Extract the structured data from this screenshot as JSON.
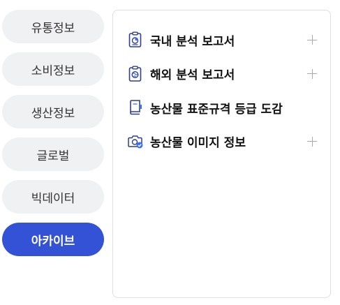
{
  "categories": [
    {
      "label": "유통정보",
      "active": false
    },
    {
      "label": "소비정보",
      "active": false
    },
    {
      "label": "생산정보",
      "active": false
    },
    {
      "label": "글로벌",
      "active": false
    },
    {
      "label": "빅데이터",
      "active": false
    },
    {
      "label": "아카이브",
      "active": true
    }
  ],
  "menu": [
    {
      "label": "국내 분석 보고서",
      "icon": "domestic-report-icon",
      "expandable": true
    },
    {
      "label": "해외 분석 보고서",
      "icon": "global-report-icon",
      "expandable": true
    },
    {
      "label": "농산물 표준규격 등급 도감",
      "icon": "standard-guide-book-icon",
      "expandable": false
    },
    {
      "label": "농산물 이미지 정보",
      "icon": "camera-check-icon",
      "expandable": true
    }
  ],
  "colors": {
    "active_bg": "#3352d6",
    "inactive_bg": "#f0f1f3",
    "icon_primary": "#2f3f8f",
    "icon_accent": "#3d6ff2",
    "plus": "#a7abb2"
  }
}
